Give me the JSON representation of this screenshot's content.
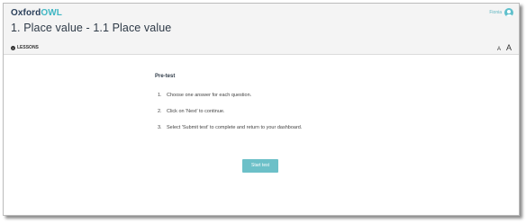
{
  "app": {
    "logo_part1": "Oxford",
    "logo_part2": "OWL",
    "user_name": "Fionia"
  },
  "header": {
    "title": "1. Place value - 1.1 Place value",
    "lessons_label": "LESSONS",
    "text_size_small": "A",
    "text_size_large": "A"
  },
  "main": {
    "heading": "Pre-test",
    "instructions": [
      {
        "num": "1.",
        "text": "Choose one answer for each question."
      },
      {
        "num": "2.",
        "text": "Click on 'Next' to continue."
      },
      {
        "num": "3.",
        "text": "Select 'Submit test' to complete and return to your dashboard."
      }
    ],
    "start_button_label": "Start test"
  },
  "colors": {
    "accent": "#6cc0c8",
    "brand_dark": "#2a3f5a",
    "brand_light": "#3fb6c3"
  }
}
